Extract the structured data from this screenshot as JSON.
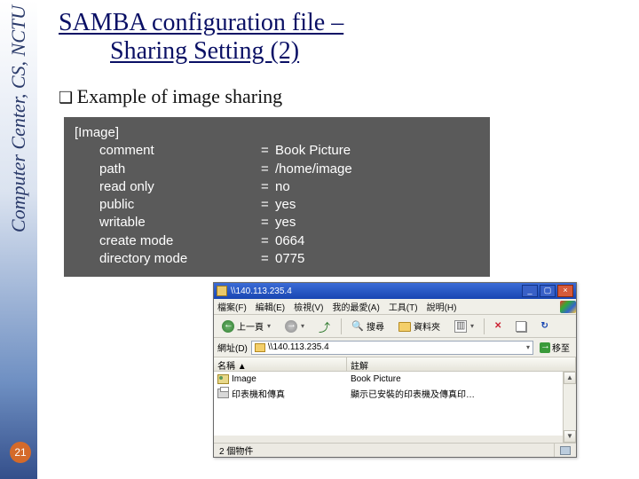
{
  "sidebar": {
    "label": "Computer Center, CS, NCTU"
  },
  "page_number": "21",
  "title": {
    "line1": "SAMBA configuration file –",
    "line2": "Sharing Setting (2)"
  },
  "bullet": "Example of image sharing",
  "config": {
    "header": "[Image]",
    "rows": [
      {
        "key": "comment",
        "val": "Book Picture"
      },
      {
        "key": "path",
        "val": "/home/image"
      },
      {
        "key": "read only",
        "val": "no"
      },
      {
        "key": "public",
        "val": "yes"
      },
      {
        "key": "writable",
        "val": "yes"
      },
      {
        "key": "create mode",
        "val": "0664"
      },
      {
        "key": "directory mode",
        "val": "0775"
      }
    ]
  },
  "explorer": {
    "title": "\\\\140.113.235.4",
    "menu": {
      "file": "檔案(F)",
      "edit": "編輯(E)",
      "view": "檢視(V)",
      "fav": "我的最愛(A)",
      "tools": "工具(T)",
      "help": "說明(H)"
    },
    "toolbar": {
      "back": "上一頁",
      "search": "搜尋",
      "folders": "資料夾"
    },
    "address": {
      "label": "網址(D)",
      "value": "\\\\140.113.235.4",
      "go": "移至"
    },
    "columns": {
      "name": "名稱 ▲",
      "desc": "註解"
    },
    "rows": [
      {
        "name": "Image",
        "desc": "Book Picture"
      },
      {
        "name": "印表機和傳真",
        "desc": "顯示已安裝的印表機及傳真印…"
      }
    ],
    "status": {
      "count": "2 個物件"
    }
  }
}
